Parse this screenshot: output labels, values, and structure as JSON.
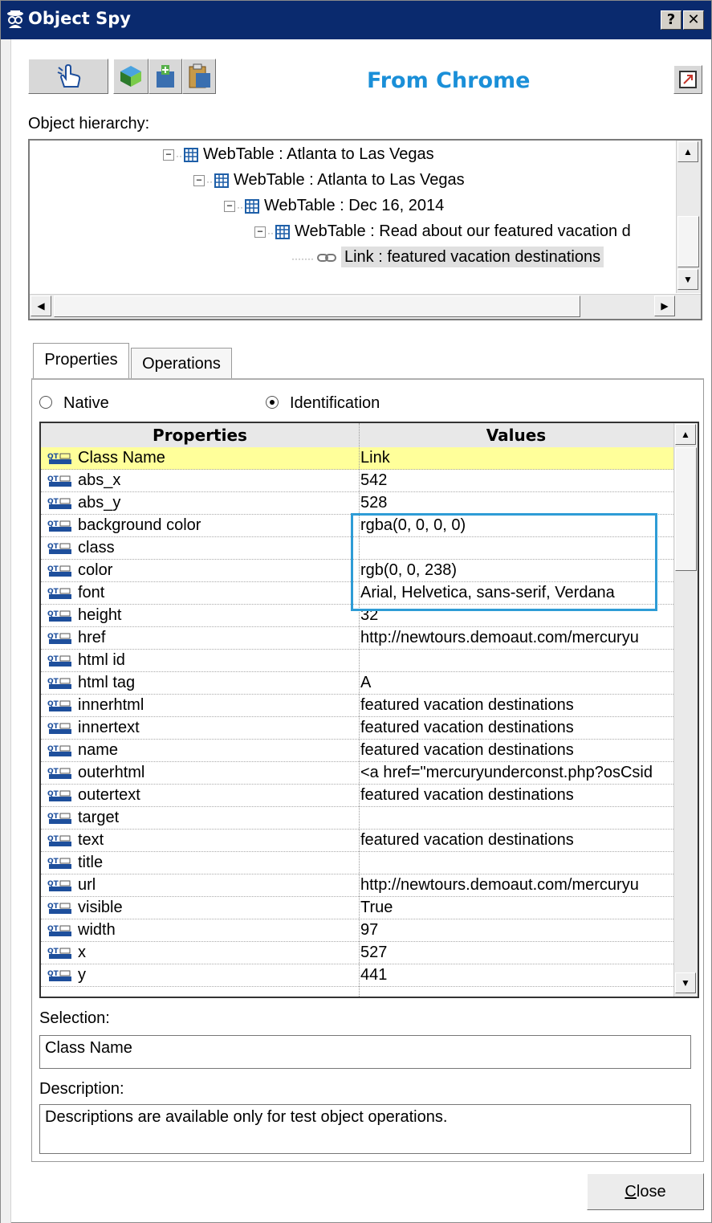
{
  "window": {
    "title": "Object Spy",
    "help_glyph": "?",
    "close_glyph": "✕"
  },
  "header": {
    "source_label": "From Chrome"
  },
  "hierarchy": {
    "label": "Object hierarchy:",
    "nodes": [
      {
        "text": "WebTable : Atlanta to Las Vegas",
        "type": "webtable",
        "expander": "−"
      },
      {
        "text": "WebTable : Atlanta to Las Vegas",
        "type": "webtable",
        "expander": "−"
      },
      {
        "text": "WebTable : Dec 16, 2014",
        "type": "webtable",
        "expander": "−"
      },
      {
        "text": "WebTable : Read about our featured vacation d",
        "type": "webtable",
        "expander": "−"
      },
      {
        "text": "Link : featured vacation destinations",
        "type": "link",
        "selected": true
      }
    ]
  },
  "tabs": [
    {
      "label": "Properties",
      "active": true
    },
    {
      "label": "Operations",
      "active": false
    }
  ],
  "view_mode": {
    "native_label": "Native",
    "identification_label": "Identification",
    "selected": "Identification"
  },
  "grid": {
    "col_properties": "Properties",
    "col_values": "Values",
    "rows": [
      {
        "property": "Class Name",
        "value": "Link",
        "highlighted": true
      },
      {
        "property": "abs_x",
        "value": "542"
      },
      {
        "property": "abs_y",
        "value": "528"
      },
      {
        "property": "background color",
        "value": "rgba(0, 0, 0, 0)"
      },
      {
        "property": "class",
        "value": ""
      },
      {
        "property": "color",
        "value": "rgb(0, 0, 238)"
      },
      {
        "property": "font",
        "value": "Arial, Helvetica, sans-serif, Verdana"
      },
      {
        "property": "height",
        "value": "32"
      },
      {
        "property": "href",
        "value": "http://newtours.demoaut.com/mercuryu"
      },
      {
        "property": "html id",
        "value": ""
      },
      {
        "property": "html tag",
        "value": "A"
      },
      {
        "property": "innerhtml",
        "value": "featured vacation destinations"
      },
      {
        "property": "innertext",
        "value": "featured vacation destinations"
      },
      {
        "property": "name",
        "value": "featured vacation destinations"
      },
      {
        "property": "outerhtml",
        "value": "<a href=\"mercuryunderconst.php?osCsid"
      },
      {
        "property": "outertext",
        "value": "featured vacation destinations"
      },
      {
        "property": "target",
        "value": ""
      },
      {
        "property": "text",
        "value": "featured vacation destinations"
      },
      {
        "property": "title",
        "value": ""
      },
      {
        "property": "url",
        "value": "http://newtours.demoaut.com/mercuryu"
      },
      {
        "property": "visible",
        "value": "True"
      },
      {
        "property": "width",
        "value": "97"
      },
      {
        "property": "x",
        "value": "527"
      },
      {
        "property": "y",
        "value": "441"
      }
    ]
  },
  "selection": {
    "label": "Selection:",
    "value": "Class Name"
  },
  "description": {
    "label": "Description:",
    "value": "Descriptions are available only for test object operations."
  },
  "buttons": {
    "close_label": "Close",
    "close_mnemonic": "C",
    "close_rest": "lose"
  },
  "colors": {
    "titlebar": "#0a2a6e",
    "accent": "#1a8fd8",
    "highlight_row": "#ffff9a",
    "callout_box": "#2e9cd6"
  },
  "icons": {
    "title": "spy-icon",
    "pointing_hand": "pointing-hand-icon",
    "object_cube": "object-cube-icon",
    "add_object": "add-object-icon",
    "clipboard": "clipboard-icon",
    "pin": "pin-icon",
    "webtable": "webtable-icon",
    "link": "link-icon",
    "property": "qt-property-icon"
  }
}
